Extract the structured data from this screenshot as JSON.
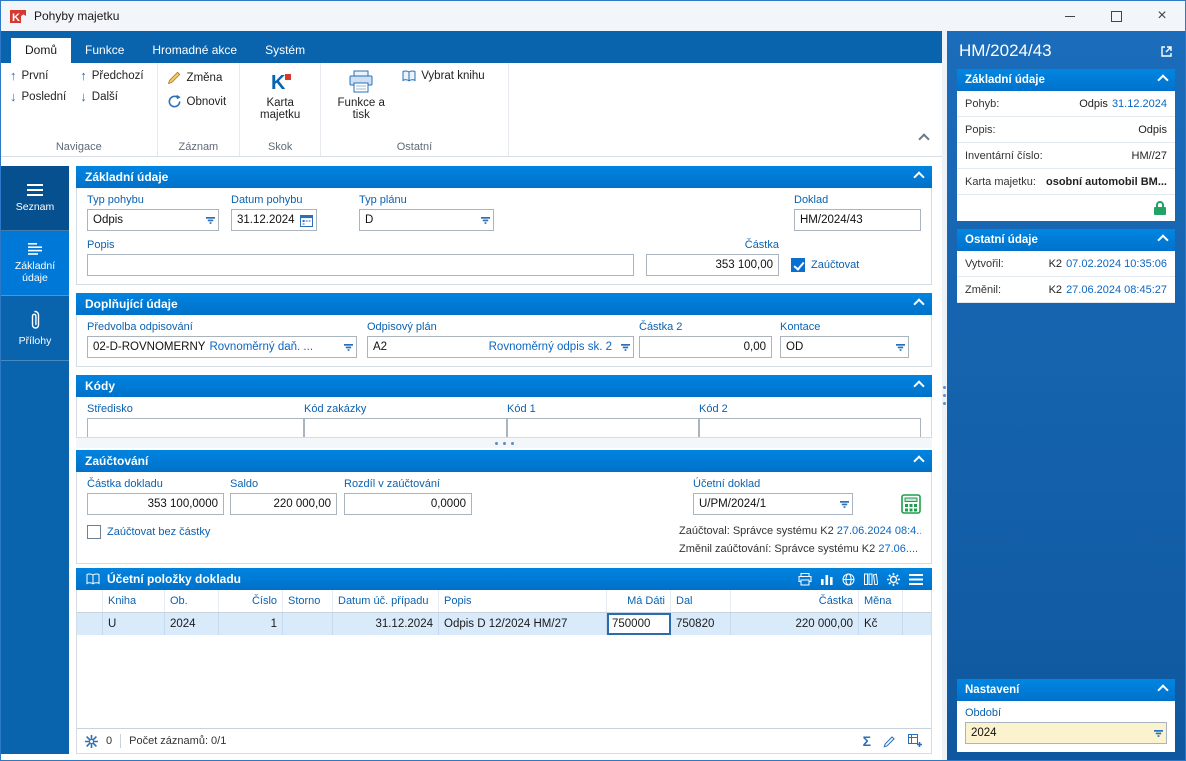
{
  "colors": {
    "accent": "#0078d7",
    "tab_bar": "#0a63ad",
    "panel_blue": "#1465b0",
    "lock_green": "#21a366",
    "value_blue": "#0b66c3"
  },
  "window": {
    "title": "Pohyby majetku"
  },
  "tabs": [
    {
      "label": "Domů"
    },
    {
      "label": "Funkce"
    },
    {
      "label": "Hromadné akce"
    },
    {
      "label": "Systém"
    }
  ],
  "ribbon": {
    "first": "První",
    "last": "Poslední",
    "prev": "Předchozí",
    "next": "Další",
    "change": "Změna",
    "refresh": "Obnovit",
    "asset_card": "Karta majetku",
    "func_print": "Funkce a tisk",
    "select_book": "Vybrat knihu",
    "groups": {
      "nav": "Navigace",
      "record": "Záznam",
      "jump": "Skok",
      "other": "Ostatní"
    }
  },
  "sidebar": {
    "items": [
      {
        "label": "Seznam"
      },
      {
        "label": "Základní údaje"
      },
      {
        "label": "Přílohy"
      }
    ]
  },
  "basic": {
    "title": "Základní údaje",
    "typ_pohybu_label": "Typ pohybu",
    "typ_pohybu": "Odpis",
    "datum_label": "Datum pohybu",
    "datum": "31.12.2024",
    "typ_planu_label": "Typ plánu",
    "typ_planu": "D",
    "doklad_label": "Doklad",
    "doklad": "HM/2024/43",
    "popis_label": "Popis",
    "popis": "",
    "castka_label": "Částka",
    "castka": "353 100,00",
    "zauctovat": "Zaúčtovat"
  },
  "additional": {
    "title": "Doplňující údaje",
    "predvolba_label": "Předvolba odpisování",
    "predvolba_code": "02-D-ROVNOMĚRNÝ",
    "predvolba_desc": "Rovnoměrný daň. ...",
    "plan_label": "Odpisový plán",
    "plan_code": "A2",
    "plan_desc": "Rovnoměrný odpis sk. 2",
    "castka2_label": "Částka 2",
    "castka2": "0,00",
    "kontace_label": "Kontace",
    "kontace": "OD"
  },
  "codes": {
    "title": "Kódy",
    "stredisko_label": "Středisko",
    "kod_zakazky_label": "Kód zakázky",
    "kod1_label": "Kód 1",
    "kod2_label": "Kód 2"
  },
  "posting": {
    "title": "Zaúčtování",
    "castka_dokladu_label": "Částka dokladu",
    "castka_dokladu": "353 100,0000",
    "saldo_label": "Saldo",
    "saldo": "220 000,00",
    "rozdil_label": "Rozdíl v zaúčtování",
    "rozdil": "0,0000",
    "ucetni_doklad_label": "Účetní doklad",
    "ucetni_doklad": "U/PM/2024/1",
    "bez_castky": "Zaúčtovat bez částky",
    "posted_label": "Zaúčtoval:",
    "posted_by": "Správce systému K2",
    "posted_date": "27.06.2024 08:4...",
    "changed_label": "Změnil zaúčtování:",
    "changed_by": "Správce systému K2",
    "changed_date": "27.06...."
  },
  "items": {
    "title": "Účetní položky dokladu",
    "columns": [
      "Kniha",
      "Ob.",
      "Číslo",
      "Storno",
      "Datum úč. případu",
      "Popis",
      "Má Dáti",
      "Dal",
      "Částka",
      "Měna"
    ],
    "row": {
      "kniha": "U",
      "ob": "2024",
      "cislo": "1",
      "storno": "",
      "datum": "31.12.2024",
      "popis": "Odpis D 12/2024  HM/27",
      "ma_dati": "750000",
      "dal": "750820",
      "castka": "220 000,00",
      "mena": "Kč"
    },
    "footer_count": "0",
    "footer_records": "Počet záznamů: 0/1"
  },
  "panel": {
    "doc_id": "HM/2024/43",
    "basic_title": "Základní údaje",
    "rows": [
      {
        "label": "Pohyb:",
        "value": "Odpis",
        "extra": "31.12.2024"
      },
      {
        "label": "Popis:",
        "value": "Odpis",
        "extra": ""
      },
      {
        "label": "Inventární číslo:",
        "value": "HM//27",
        "extra": ""
      },
      {
        "label": "Karta majetku:",
        "value": "osobní automobil BM...",
        "extra": ""
      }
    ],
    "other_title": "Ostatní údaje",
    "other_rows": [
      {
        "label": "Vytvořil:",
        "value": "K2",
        "extra": "07.02.2024 10:35:06"
      },
      {
        "label": "Změnil:",
        "value": "K2",
        "extra": "27.06.2024 08:45:27"
      }
    ],
    "settings_title": "Nastavení",
    "obdobi_label": "Období",
    "obdobi": "2024"
  }
}
